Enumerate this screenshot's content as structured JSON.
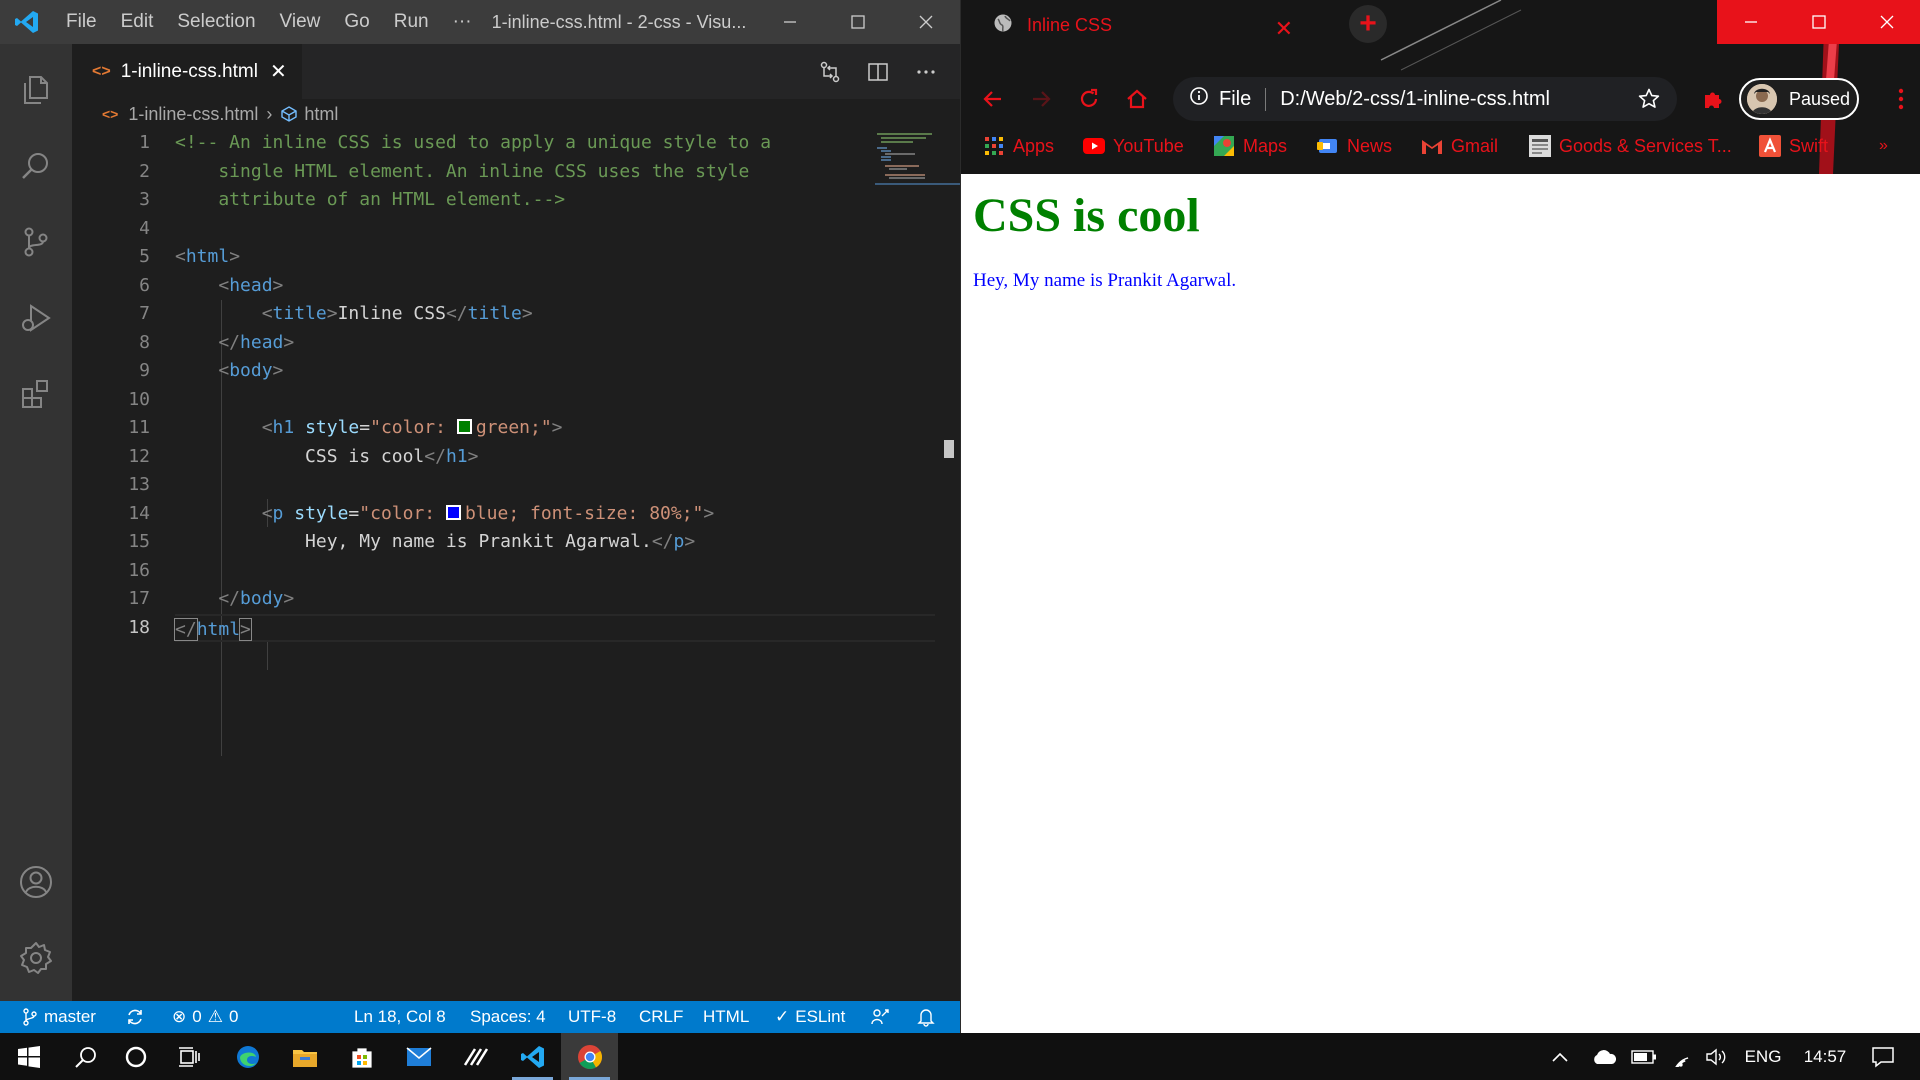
{
  "vscode": {
    "menu": [
      "File",
      "Edit",
      "Selection",
      "View",
      "Go",
      "Run",
      "···"
    ],
    "window_title": "1-inline-css.html - 2-css - Visu...",
    "tab": {
      "filename": "1-inline-css.html",
      "icon": "html-file-icon"
    },
    "breadcrumb": {
      "file": "1-inline-css.html",
      "symbol": "html"
    },
    "code": {
      "line_numbers": [
        "1",
        "2",
        "3",
        "4",
        "5",
        "6",
        "7",
        "8",
        "9",
        "10",
        "11",
        "12",
        "13",
        "14",
        "15",
        "16",
        "17",
        "18"
      ],
      "active_line": 18,
      "l1": "<!-- An inline CSS is used to apply a unique style to a",
      "l2": "    single HTML element. An inline CSS uses the style",
      "l3": "    attribute of an HTML element.-->",
      "l5_open": "<",
      "l5_tag": "html",
      "l5_close": ">",
      "l6_open": "    <",
      "l6_tag": "head",
      "l6_close": ">",
      "l7_indent": "        ",
      "l7_lt": "<",
      "l7_tag1": "title",
      "l7_gt": ">",
      "l7_text": "Inline CSS",
      "l7_lt2": "</",
      "l7_tag2": "title",
      "l7_gt2": ">",
      "l8_open": "    </",
      "l8_tag": "head",
      "l8_close": ">",
      "l9_open": "    <",
      "l9_tag": "body",
      "l9_close": ">",
      "l11_indent": "        ",
      "l11_lt": "<",
      "l11_tag": "h1",
      "l11_attr": " style",
      "l11_eq": "=",
      "l11_str1": "\"color: ",
      "l11_str2": "green;\"",
      "l11_gt": ">",
      "l12_indent": "            ",
      "l12_text": "CSS is cool",
      "l12_lt": "</",
      "l12_tag": "h1",
      "l12_gt": ">",
      "l14_indent": "        ",
      "l14_lt": "<",
      "l14_tag": "p",
      "l14_attr": " style",
      "l14_eq": "=",
      "l14_str1": "\"color: ",
      "l14_str2": "blue; font-size: 80%;\"",
      "l14_gt": ">",
      "l15_indent": "            ",
      "l15_text": "Hey, My name is Prankit Agarwal.",
      "l15_lt": "</",
      "l15_tag": "p",
      "l15_gt": ">",
      "l17_open": "    </",
      "l17_tag": "body",
      "l17_close": ">",
      "l18_open": "</",
      "l18_tag": "html",
      "l18_close": ">",
      "swatch_green": "#008000",
      "swatch_blue": "#0000ff"
    },
    "status": {
      "branch": "master",
      "errors": "0",
      "warnings": "0",
      "position": "Ln 18, Col 8",
      "spaces": "Spaces: 4",
      "encoding": "UTF-8",
      "eol": "CRLF",
      "language": "HTML",
      "eslint": "ESLint"
    },
    "colors": {
      "statusbar": "#007acc",
      "titlebar": "#3c3c3c",
      "editor": "#1e1e1e"
    }
  },
  "chrome": {
    "tab_title": "Inline CSS",
    "omnibox": {
      "scheme_label": "File",
      "url": "D:/Web/2-css/1-inline-css.html"
    },
    "profile_label": "Paused",
    "bookmarks": [
      {
        "label": "Apps",
        "icon": "apps-grid-icon"
      },
      {
        "label": "YouTube",
        "icon": "youtube-icon"
      },
      {
        "label": "Maps",
        "icon": "maps-icon"
      },
      {
        "label": "News",
        "icon": "news-icon"
      },
      {
        "label": "Gmail",
        "icon": "gmail-icon"
      },
      {
        "label": "Goods & Services T...",
        "icon": "gst-icon"
      },
      {
        "label": "Swift",
        "icon": "swift-icon"
      }
    ],
    "page": {
      "heading": "CSS is cool",
      "paragraph": "Hey, My name is Prankit Agarwal."
    },
    "colors": {
      "accent": "#e8121a",
      "toolbar": "#161616"
    }
  },
  "taskbar": {
    "apps": [
      "start-icon",
      "search-icon",
      "cortana-icon",
      "task-view-icon",
      "edge-icon",
      "file-explorer-icon",
      "store-icon",
      "mail-icon",
      "app-icon",
      "vscode-icon",
      "chrome-icon"
    ],
    "language": "ENG",
    "time": "14:57"
  }
}
